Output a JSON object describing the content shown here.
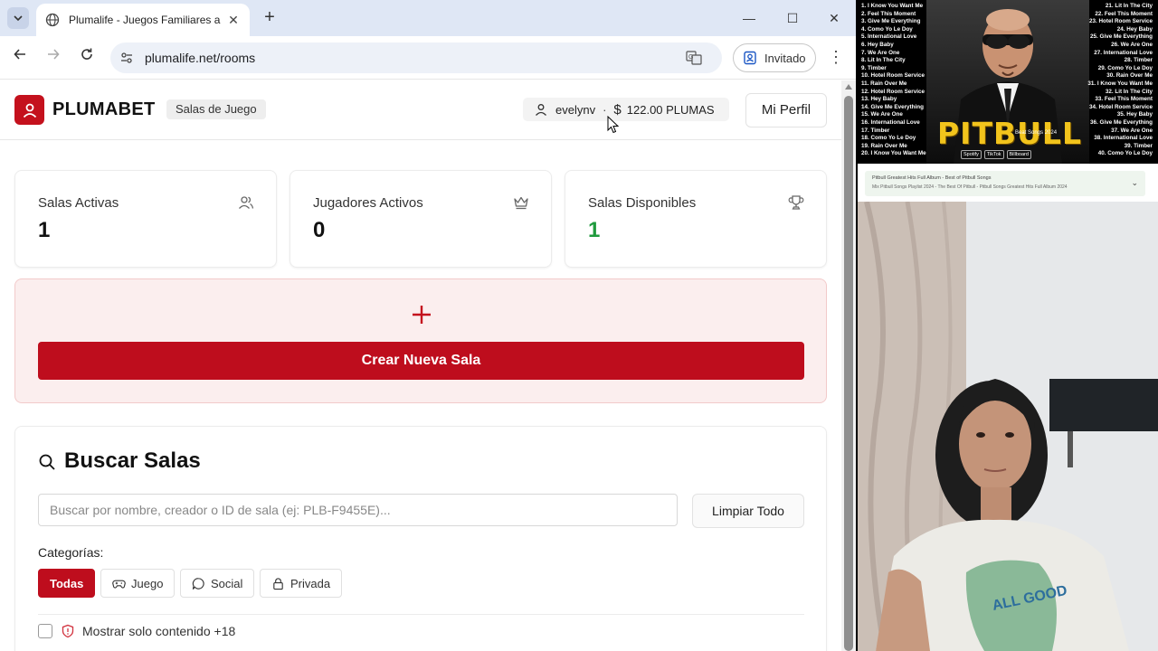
{
  "browser": {
    "tab_title": "Plumalife - Juegos Familiares a",
    "url": "plumalife.net/rooms",
    "guest_label": "Invitado"
  },
  "header": {
    "brand": "PLUMABET",
    "section_badge": "Salas de Juego",
    "username": "evelynv",
    "balance": "122.00 PLUMAS",
    "profile_button": "Mi Perfil"
  },
  "stats": [
    {
      "label": "Salas Activas",
      "value": "1",
      "icon": "users-icon"
    },
    {
      "label": "Jugadores Activos",
      "value": "0",
      "icon": "crown-icon"
    },
    {
      "label": "Salas Disponibles",
      "value": "1",
      "icon": "trophy-icon",
      "value_color": "#1f9a3d"
    }
  ],
  "create": {
    "button_label": "Crear Nueva Sala"
  },
  "search": {
    "title": "Buscar Salas",
    "placeholder": "Buscar por nombre, creador o ID de sala (ej: PLB-F9455E)...",
    "clear_button": "Limpiar Todo",
    "categories_label": "Categorías:",
    "categories": [
      {
        "label": "Todas",
        "active": true
      },
      {
        "label": "Juego",
        "icon": "gamepad-icon"
      },
      {
        "label": "Social",
        "icon": "chat-icon"
      },
      {
        "label": "Privada",
        "icon": "lock-icon"
      }
    ],
    "adult_filter_label": "Mostrar solo contenido +18"
  },
  "video": {
    "artist": "PITBULL",
    "subtitle": "Beat Songs 2024",
    "tracks_left": [
      "1. I Know You Want Me",
      "2. Feel This Moment",
      "3. Give Me Everything",
      "4. Como Yo Le Doy",
      "5. International Love",
      "6. Hey Baby",
      "7. We Are One",
      "8. Lit In The City",
      "9. Timber",
      "10. Hotel Room Service",
      "11. Rain Over Me",
      "12. Hotel Room Service",
      "13. Hey Baby",
      "14. Give Me Everything",
      "15. We Are One",
      "16. International Love",
      "17. Timber",
      "18. Como Yo Le Doy",
      "19. Rain Over Me",
      "20. I Know You Want Me"
    ],
    "tracks_right": [
      "21. Lit In The City",
      "22. Feel This Moment",
      "23. Hotel Room Service",
      "24. Hey Baby",
      "25. Give Me Everything",
      "26. We Are One",
      "27. International Love",
      "28. Timber",
      "29. Como Yo Le Doy",
      "30. Rain Over Me",
      "31. I Know You Want Me",
      "32. Lit In The City",
      "33. Feel This Moment",
      "34. Hotel Room Service",
      "35. Hey Baby",
      "36. Give Me Everything",
      "37. We Are One",
      "38. International Love",
      "39. Timber",
      "40. Como Yo Le Doy"
    ],
    "platform_logos": [
      "Spotify",
      "TikTok",
      "Billboard"
    ],
    "info_line1": "Pitbull Greatest Hits Full Album - Best of Pitbull Songs",
    "info_line2": "Mix Pitbull Songs Playlist 2024 - The Best Of Pitbull - Pitbull Songs Greatest Hits Full Album 2024"
  },
  "colors": {
    "accent": "#be0d1d",
    "available_green": "#1f9a3d",
    "create_card_bg": "#fbeeee"
  }
}
